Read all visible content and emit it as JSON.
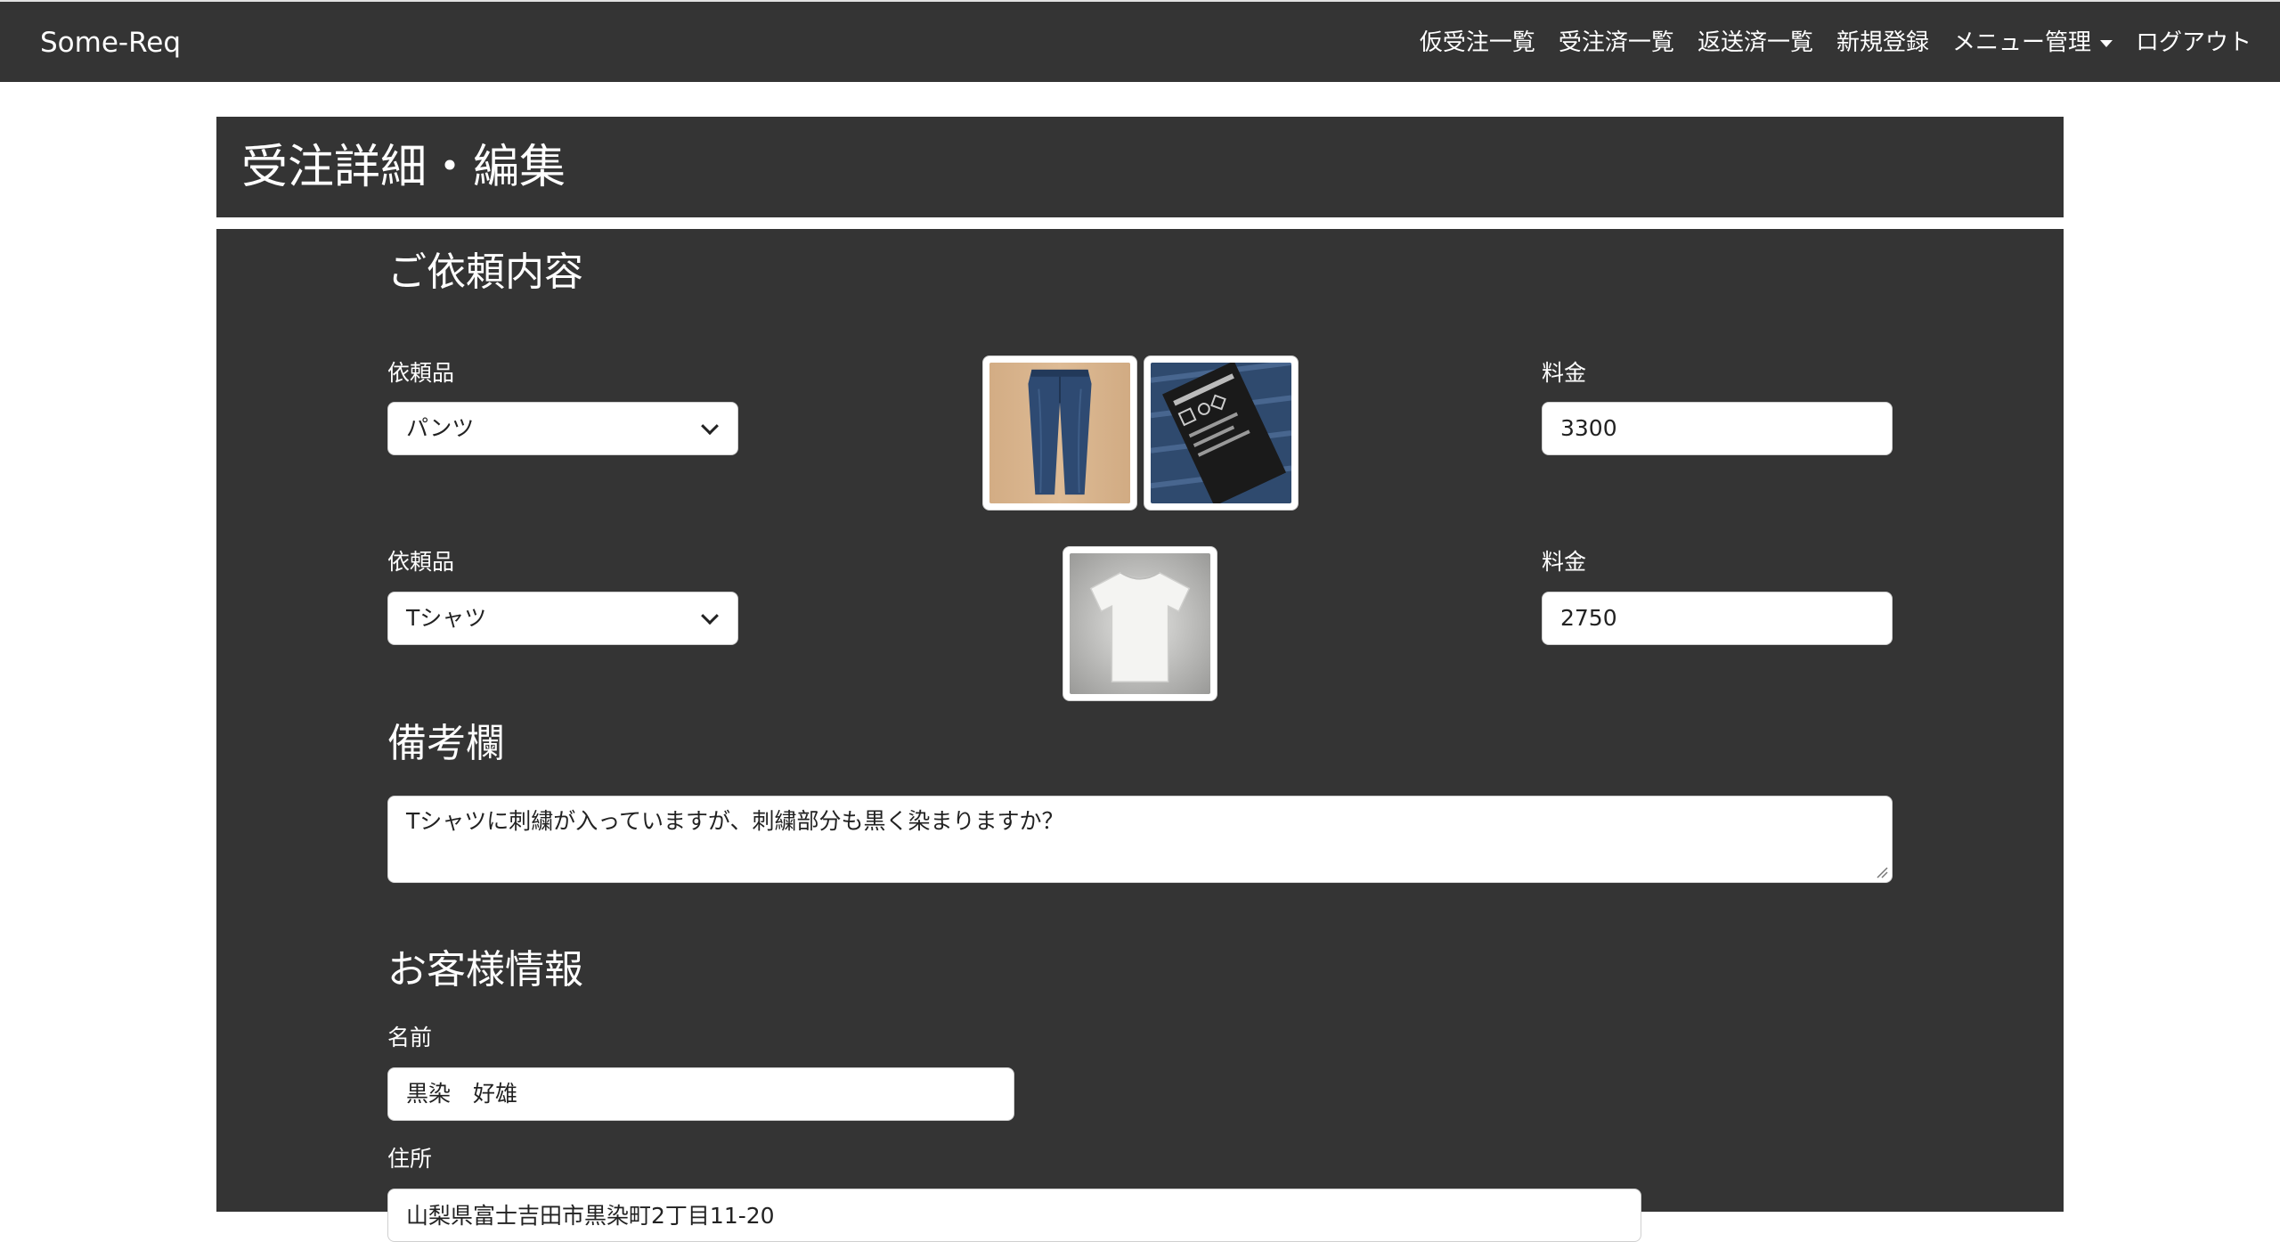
{
  "navbar": {
    "brand": "Some-Req",
    "links": [
      {
        "label": "仮受注一覧"
      },
      {
        "label": "受注済一覧"
      },
      {
        "label": "返送済一覧"
      },
      {
        "label": "新規登録"
      },
      {
        "label": "メニュー管理"
      },
      {
        "label": "ログアウト"
      }
    ]
  },
  "header": {
    "title": "受注詳細・編集"
  },
  "request": {
    "section_title": "ご依頼内容",
    "items": [
      {
        "item_label": "依頼品",
        "item_value": "パンツ",
        "price_label": "料金",
        "price_value": "3300",
        "images": [
          "jeans-photo",
          "jeans-tag-photo"
        ]
      },
      {
        "item_label": "依頼品",
        "item_value": "Tシャツ",
        "price_label": "料金",
        "price_value": "2750",
        "images": [
          "tshirt-photo"
        ]
      }
    ]
  },
  "notes": {
    "section_title": "備考欄",
    "value": "Tシャツに刺繍が入っていますが、刺繍部分も黒く染まりますか？"
  },
  "customer": {
    "section_title": "お客様情報",
    "name_label": "名前",
    "name_value": "黒染　好雄",
    "address_label": "住所",
    "address_value": "山梨県富士吉田市黒染町2丁目11-20"
  }
}
